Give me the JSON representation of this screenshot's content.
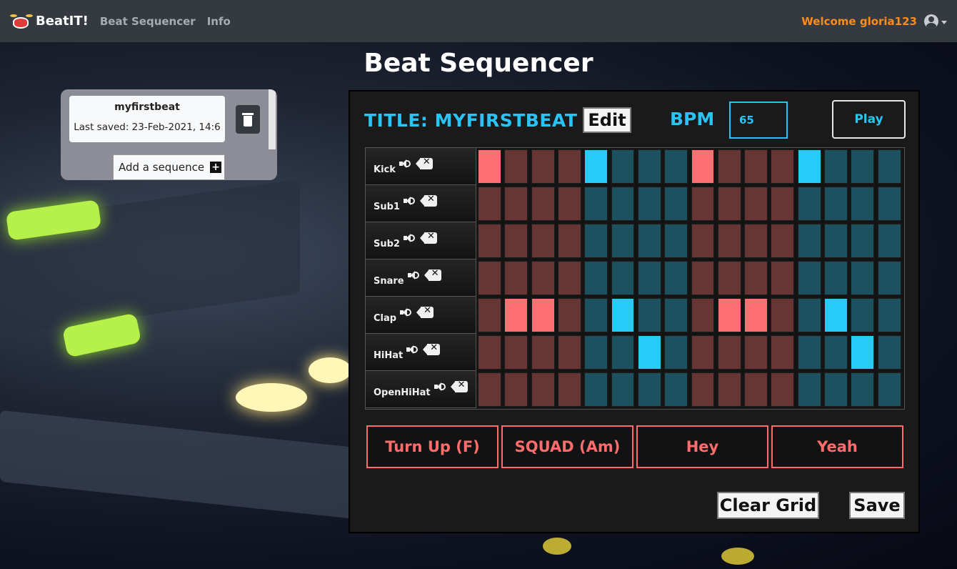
{
  "nav": {
    "brand": "BeatIT!",
    "links": [
      "Beat Sequencer",
      "Info"
    ],
    "welcome": "Welcome gloria123"
  },
  "page_title": "Beat Sequencer",
  "sequence_list": {
    "items": [
      {
        "name": "myfirstbeat",
        "last_saved": "Last saved: 23-Feb-2021, 14:6"
      }
    ],
    "add_label": "Add a sequence"
  },
  "sequencer": {
    "title": "TITLE: MYFIRSTBEAT",
    "edit_label": "Edit",
    "bpm_label": "BPM",
    "bpm_value": "65",
    "play_label": "Play",
    "instruments": [
      "Kick",
      "Sub1",
      "Sub2",
      "Snare",
      "Clap",
      "HiHat",
      "OpenHiHat"
    ],
    "steps": 16,
    "group_colors": [
      "red",
      "teal",
      "red",
      "teal"
    ],
    "active_steps": {
      "Kick": [
        0,
        4,
        8,
        12
      ],
      "Sub1": [],
      "Sub2": [],
      "Snare": [],
      "Clap": [
        1,
        2,
        5,
        9,
        10,
        13
      ],
      "HiHat": [
        6,
        14
      ],
      "OpenHiHat": []
    },
    "pads": [
      "Turn Up (F)",
      "SQUAD (Am)",
      "Hey",
      "Yeah"
    ],
    "clear_label": "Clear Grid",
    "save_label": "Save"
  },
  "colors": {
    "accent_blue": "#29c4f5",
    "pad_red": "#ff6c6c",
    "welcome_orange": "#ff8c1a",
    "cell_red_off": "#673534",
    "cell_red_on": "#ff7074",
    "cell_teal_off": "#1c5160",
    "cell_teal_on": "#26ccf8"
  },
  "icons": [
    "drum-logo-icon",
    "user-circle-icon",
    "caret-down-icon",
    "trash-icon",
    "plus-icon",
    "speaker-icon",
    "backspace-icon"
  ]
}
